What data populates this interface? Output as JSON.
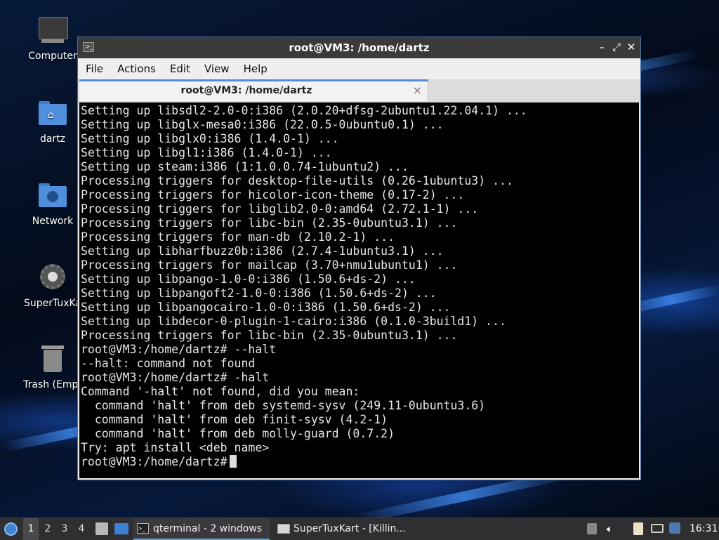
{
  "desktop": {
    "icons": [
      {
        "label": "Computer",
        "icon": "computer-icon"
      },
      {
        "label": "dartz",
        "icon": "home-folder-icon"
      },
      {
        "label": "Network",
        "icon": "network-folder-icon"
      },
      {
        "label": "SuperTuxKa",
        "icon": "gear-icon"
      },
      {
        "label": "Trash (Empt",
        "icon": "trash-icon"
      }
    ]
  },
  "window": {
    "title": "root@VM3: /home/dartz",
    "menu": [
      "File",
      "Actions",
      "Edit",
      "View",
      "Help"
    ],
    "tab_title": "root@VM3: /home/dartz",
    "tab_close": "×",
    "terminal_lines": [
      "Setting up libsdl2-2.0-0:i386 (2.0.20+dfsg-2ubuntu1.22.04.1) ...",
      "Setting up libglx-mesa0:i386 (22.0.5-0ubuntu0.1) ...",
      "Setting up libglx0:i386 (1.4.0-1) ...",
      "Setting up libgl1:i386 (1.4.0-1) ...",
      "Setting up steam:i386 (1:1.0.0.74-1ubuntu2) ...",
      "Processing triggers for desktop-file-utils (0.26-1ubuntu3) ...",
      "Processing triggers for hicolor-icon-theme (0.17-2) ...",
      "Processing triggers for libglib2.0-0:amd64 (2.72.1-1) ...",
      "Processing triggers for libc-bin (2.35-0ubuntu3.1) ...",
      "Processing triggers for man-db (2.10.2-1) ...",
      "Setting up libharfbuzz0b:i386 (2.7.4-1ubuntu3.1) ...",
      "Processing triggers for mailcap (3.70+nmu1ubuntu1) ...",
      "Setting up libpango-1.0-0:i386 (1.50.6+ds-2) ...",
      "Setting up libpangoft2-1.0-0:i386 (1.50.6+ds-2) ...",
      "Setting up libpangocairo-1.0-0:i386 (1.50.6+ds-2) ...",
      "Setting up libdecor-0-plugin-1-cairo:i386 (0.1.0-3build1) ...",
      "Processing triggers for libc-bin (2.35-0ubuntu3.1) ...",
      "root@VM3:/home/dartz# --halt",
      "--halt: command not found",
      "root@VM3:/home/dartz# -halt",
      "Command '-halt' not found, did you mean:",
      "  command 'halt' from deb systemd-sysv (249.11-0ubuntu3.6)",
      "  command 'halt' from deb finit-sysv (4.2-1)",
      "  command 'halt' from deb molly-guard (0.7.2)",
      "Try: apt install <deb name>"
    ],
    "prompt": "root@VM3:/home/dartz# "
  },
  "taskbar": {
    "workspaces": [
      "1",
      "2",
      "3",
      "4"
    ],
    "active_workspace": "1",
    "tasks": [
      {
        "label": "qterminal - 2 windows",
        "icon": "terminal-icon"
      },
      {
        "label": "SuperTuxKart - [Killin...",
        "icon": "window-icon"
      }
    ],
    "clock": "16:31"
  }
}
